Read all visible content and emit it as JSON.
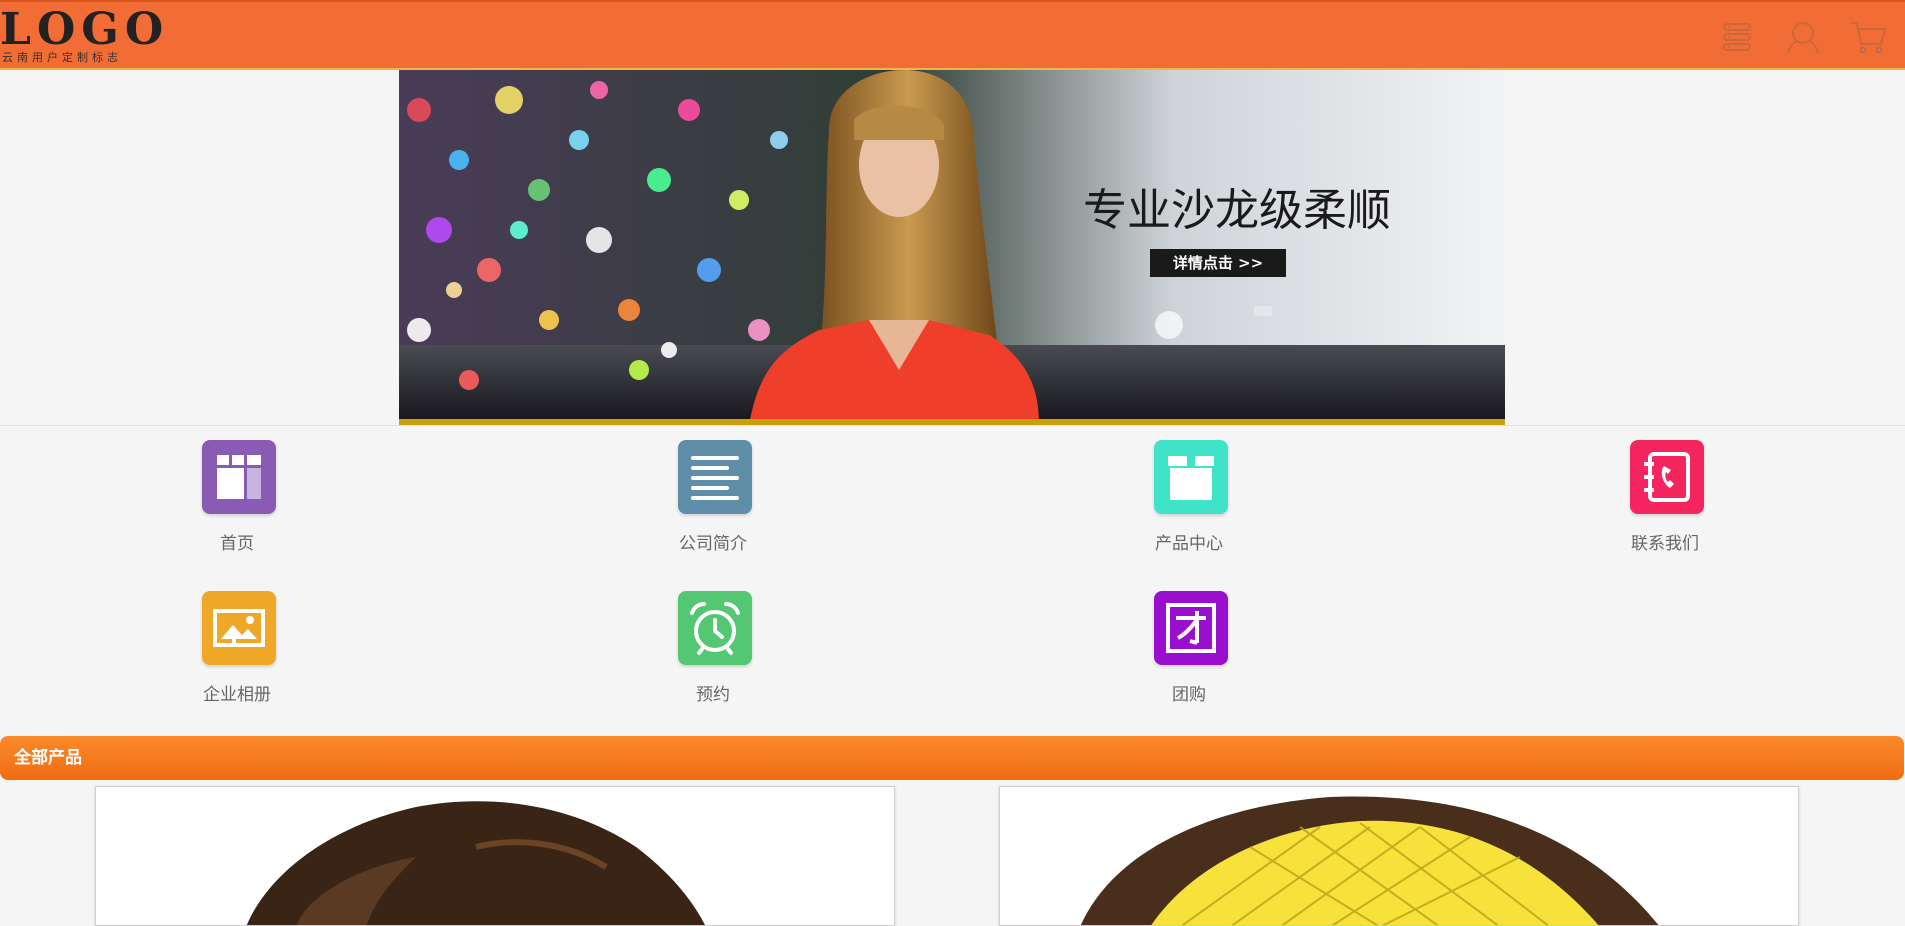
{
  "header": {
    "logo_text": "LOGO",
    "logo_subtitle": "云南用户定制标志",
    "icons": [
      "menu-icon",
      "user-icon",
      "cart-icon"
    ],
    "background_color": "#f26d35"
  },
  "banner": {
    "headline": "专业沙龙级柔顺",
    "button_label": "详情点击 >>"
  },
  "nav": {
    "items": [
      {
        "label": "首页",
        "icon": "home-icon",
        "color": "#8a5bb4"
      },
      {
        "label": "公司简介",
        "icon": "document-icon",
        "color": "#5f8fa8"
      },
      {
        "label": "产品中心",
        "icon": "box-icon",
        "color": "#3ee3c8"
      },
      {
        "label": "联系我们",
        "icon": "contact-book-icon",
        "color": "#f5265f"
      },
      {
        "label": "企业相册",
        "icon": "photo-album-icon",
        "color": "#eea726"
      },
      {
        "label": "预约",
        "icon": "alarm-clock-icon",
        "color": "#53c771"
      },
      {
        "label": "团购",
        "icon": "group-buy-icon",
        "color": "#9a0fcf"
      }
    ]
  },
  "products": {
    "section_title": "全部产品",
    "accent_color": "#f47a1f"
  }
}
